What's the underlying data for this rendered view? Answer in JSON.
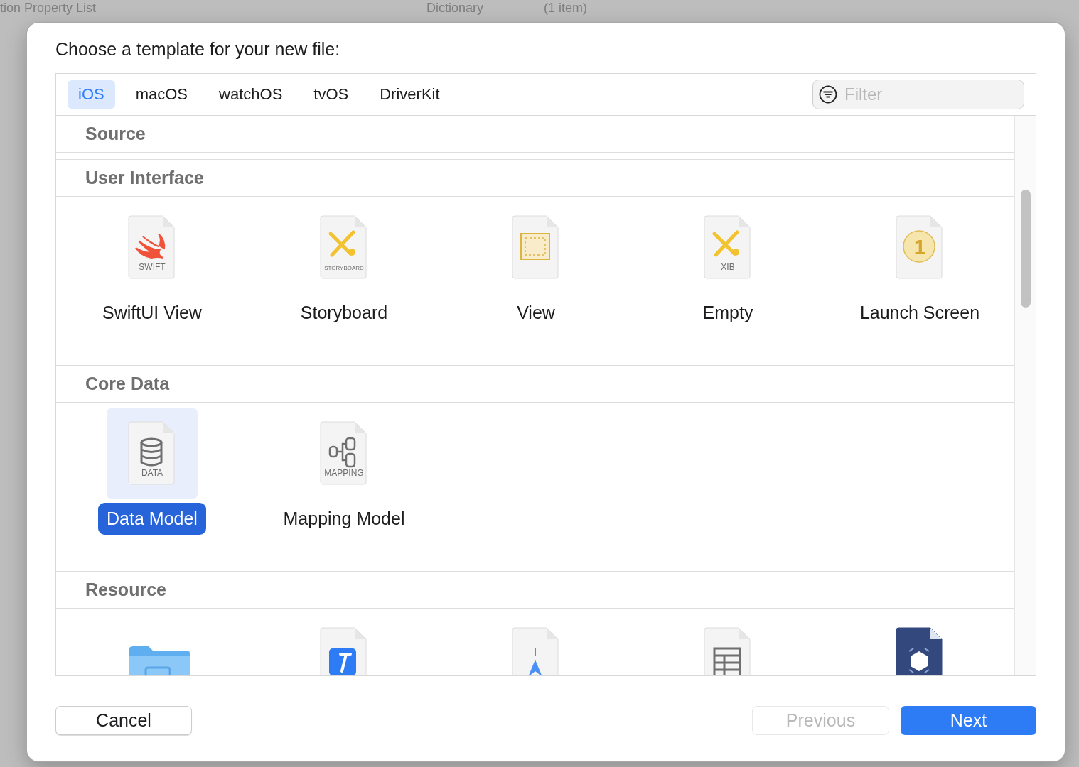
{
  "background": {
    "rows": [
      {
        "name": "tion Property List",
        "type": "Dictionary",
        "value": "(1 item)"
      }
    ]
  },
  "dialog": {
    "title": "Choose a template for your new file:",
    "tabs": [
      {
        "label": "iOS",
        "selected": true
      },
      {
        "label": "macOS",
        "selected": false
      },
      {
        "label": "watchOS",
        "selected": false
      },
      {
        "label": "tvOS",
        "selected": false
      },
      {
        "label": "DriverKit",
        "selected": false
      }
    ],
    "filter": {
      "placeholder": "Filter"
    },
    "sections": [
      {
        "title": "Source"
      },
      {
        "title": "User Interface",
        "items": [
          {
            "kind": "swift",
            "badge": "SWIFT",
            "label": "SwiftUI View",
            "selected": false
          },
          {
            "kind": "storyboard",
            "badge": "STORYBOARD",
            "label": "Storyboard",
            "selected": false
          },
          {
            "kind": "view",
            "label": "View",
            "selected": false
          },
          {
            "kind": "xib",
            "badge": "XIB",
            "label": "Empty",
            "selected": false
          },
          {
            "kind": "launch",
            "badge": "1",
            "label": "Launch Screen",
            "selected": false
          }
        ]
      },
      {
        "title": "Core Data",
        "items": [
          {
            "kind": "data",
            "badge": "DATA",
            "label": "Data Model",
            "selected": true
          },
          {
            "kind": "mapping",
            "badge": "MAPPING",
            "label": "Mapping Model",
            "selected": false
          }
        ]
      },
      {
        "title": "Resource",
        "items": [
          {
            "kind": "folder",
            "selected": false
          },
          {
            "kind": "hammer",
            "selected": false
          },
          {
            "kind": "arrow",
            "selected": false
          },
          {
            "kind": "table",
            "selected": false
          },
          {
            "kind": "cube",
            "selected": false
          }
        ]
      }
    ],
    "buttons": [
      {
        "label": "Cancel",
        "kind": "plain",
        "disabled": false
      },
      {
        "label": "Previous",
        "kind": "plain",
        "disabled": true
      },
      {
        "label": "Next",
        "kind": "primary",
        "disabled": false
      }
    ]
  }
}
